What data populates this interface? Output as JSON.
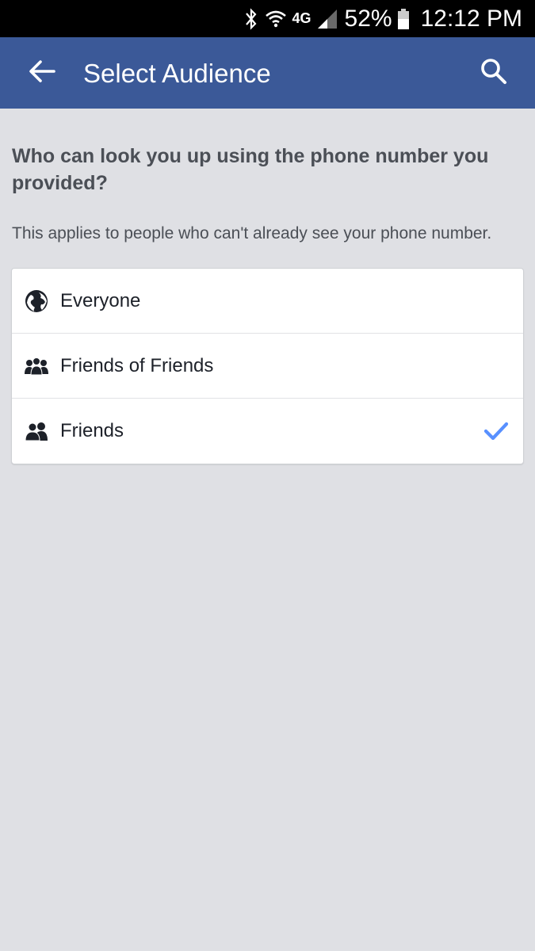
{
  "status_bar": {
    "network": "4G",
    "battery": "52%",
    "time": "12:12 PM",
    "icons": [
      "bluetooth-icon",
      "wifi-icon",
      "signal-icon",
      "battery-icon"
    ]
  },
  "app_bar": {
    "title": "Select Audience",
    "back_icon": "arrow-left-icon",
    "search_icon": "search-icon",
    "color": "#3b5998"
  },
  "content": {
    "question": "Who can look you up using the phone number you provided?",
    "subtext": "This applies to people who can't already see your phone number."
  },
  "options": [
    {
      "label": "Everyone",
      "icon": "globe-icon",
      "selected": false
    },
    {
      "label": "Friends of Friends",
      "icon": "friends-of-friends-icon",
      "selected": false
    },
    {
      "label": "Friends",
      "icon": "friends-icon",
      "selected": true
    }
  ],
  "colors": {
    "accent": "#5890ff",
    "background": "#dfe0e4"
  }
}
